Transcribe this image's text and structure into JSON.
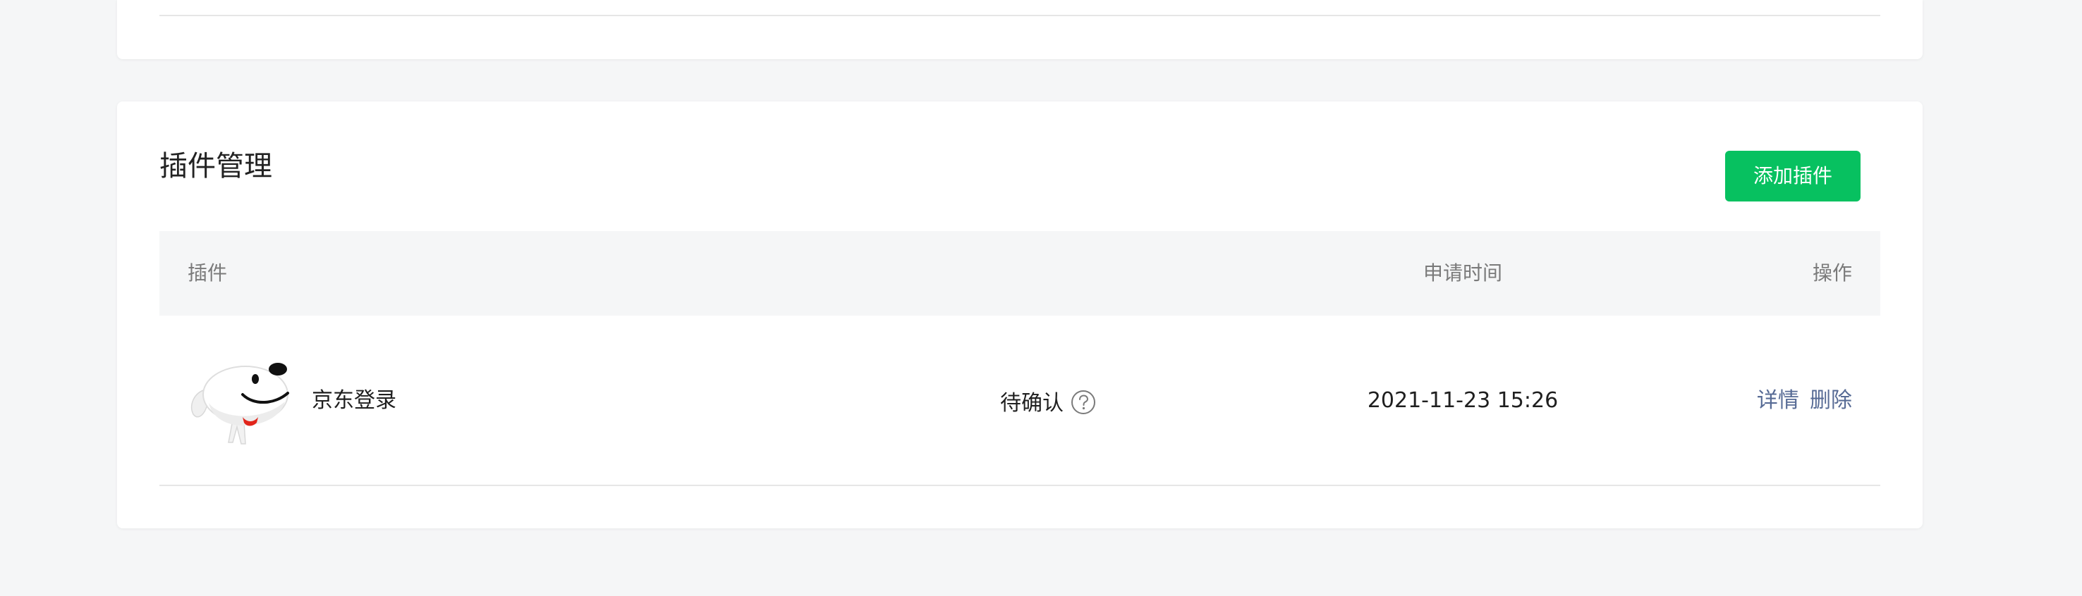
{
  "section": {
    "title": "插件管理",
    "add_button_label": "添加插件"
  },
  "table": {
    "columns": {
      "plugin": "插件",
      "apply_time": "申请时间",
      "action": "操作"
    },
    "rows": [
      {
        "icon": "jd-joy-mascot-icon",
        "name": "京东登录",
        "status": "待确认",
        "apply_time": "2021-11-23 15:26",
        "actions": {
          "detail": "详情",
          "delete": "删除"
        }
      }
    ]
  },
  "colors": {
    "primary": "#07c160",
    "link": "#576b95",
    "page_background": "#f5f6f7",
    "table_header_background": "#f5f6f7",
    "mascot_collar": "#e1251b"
  }
}
